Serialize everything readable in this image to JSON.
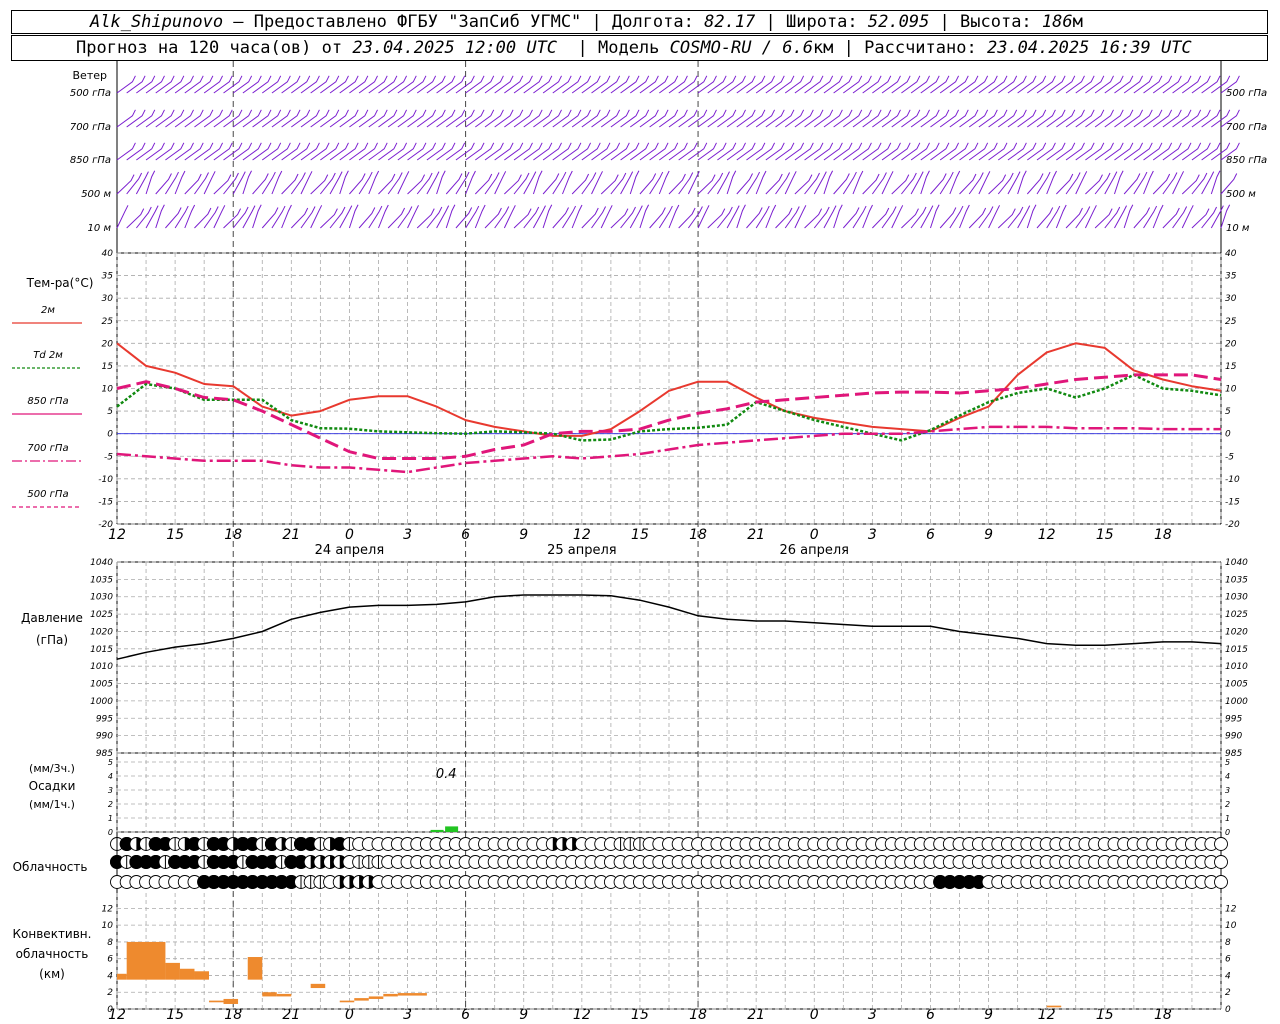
{
  "header": {
    "station": "Alk_Shipunovo",
    "provided_by": " – Предоставлено ФГБУ \"ЗапСиб УГМС\" | Долгота: ",
    "lon": "82.17",
    "lat_label": " | Широта: ",
    "lat": "52.095",
    "alt_label": " | Высота: ",
    "alt": "186",
    "alt_unit": "м",
    "forecast_label": "Прогноз на 120 часа(ов) от ",
    "forecast_time": "23.04.2025 12:00 UTC",
    "model_label": "  | Модель ",
    "model": "COSMO-RU / 6.6",
    "model_unit": "км",
    "calc_label": " | Рассчитано: ",
    "calc_time": "23.04.2025 16:39 UTC"
  },
  "x_axis": {
    "hour_ticks": [
      "12",
      "15",
      "18",
      "21",
      "0",
      "3",
      "6",
      "9",
      "12",
      "15",
      "18",
      "21",
      "0",
      "3",
      "6",
      "9",
      "12",
      "15",
      "18"
    ],
    "day_labels": [
      "24 апреля",
      "25 апреля",
      "26 апреля"
    ]
  },
  "colors": {
    "wind": "#7b1fd0",
    "t2m": "#e8392f",
    "td2m": "#118a11",
    "t850": "#e0167a",
    "t700": "#e0167a",
    "t500": "#e0167a",
    "zero_line": "#2a2ae0",
    "precip": "#22c422",
    "convective": "#ee8a2e",
    "pressure": "#000000"
  },
  "chart_data": [
    {
      "type": "wind_barbs",
      "panel_label": "Ветер",
      "levels": [
        "500 гПа",
        "700 гПа",
        "850 гПа",
        "500 м",
        "10 м"
      ],
      "note": "wind barbs drawn every hour for each level"
    },
    {
      "type": "line",
      "ylabel": "Тем-ра(°C)",
      "ylim": [
        -20,
        40
      ],
      "yticks": [
        -20,
        -15,
        -10,
        -5,
        0,
        5,
        10,
        15,
        20,
        25,
        30,
        35,
        40
      ],
      "x_hours": [
        0,
        3,
        6,
        9,
        12,
        15,
        18,
        21,
        24,
        27,
        30,
        33,
        36,
        39,
        42,
        45,
        48,
        51,
        54,
        57,
        60,
        63,
        66,
        69,
        72,
        75,
        78,
        81,
        84,
        87,
        90,
        93,
        96,
        99,
        102,
        105,
        108,
        111,
        114
      ],
      "series": [
        {
          "name": "2м",
          "values": [
            20,
            15,
            13.5,
            11,
            10.5,
            6,
            4,
            5,
            7.5,
            8.3,
            8.3,
            6,
            3,
            1.5,
            0.5,
            -0.5,
            -0.5,
            1,
            5,
            9.5,
            11.5,
            11.5,
            8,
            5,
            3.5,
            2.5,
            1.5,
            1,
            0.5,
            3.5,
            6,
            13,
            18,
            20,
            19,
            14,
            12,
            10.5,
            9.5
          ]
        },
        {
          "name": "Td 2м",
          "values": [
            6,
            11,
            10,
            7.5,
            7.5,
            7.5,
            3,
            1.2,
            1.1,
            0.5,
            0.3,
            0.1,
            0,
            0.5,
            0.3,
            0,
            -1.5,
            -1.3,
            0.5,
            1,
            1.3,
            2,
            7,
            5,
            3,
            1.5,
            0,
            -1.5,
            0.8,
            4,
            7,
            9,
            10,
            8,
            10,
            13,
            10,
            9.5,
            8.5
          ]
        },
        {
          "name": "850 гПа",
          "values": [
            10,
            11.5,
            10,
            8,
            7.5,
            5,
            2,
            -1,
            -4,
            -5.5,
            -5.5,
            -5.5,
            -5,
            -3.5,
            -2.5,
            0,
            0.5,
            0.5,
            1,
            3,
            4.5,
            5.5,
            7,
            7.5,
            8,
            8.5,
            9,
            9.2,
            9.2,
            9,
            9.5,
            10,
            11,
            12,
            12.5,
            13,
            13,
            13,
            12
          ]
        },
        {
          "name": "700 гПа",
          "values": [
            -4.5,
            -5,
            -5.5,
            -6,
            -6,
            -6,
            -7,
            -7.5,
            -7.5,
            -8,
            -8.5,
            -7.5,
            -6.5,
            -6,
            -5.5,
            -5,
            -5.5,
            -5,
            -4.5,
            -3.5,
            -2.5,
            -2,
            -1.5,
            -1,
            -0.5,
            0,
            0,
            0,
            0.5,
            1,
            1.5,
            1.5,
            1.5,
            1.2,
            1.2,
            1.2,
            1,
            1,
            1
          ]
        },
        {
          "name": "500 гПа",
          "values": []
        }
      ]
    },
    {
      "type": "line",
      "ylabel": "Давление",
      "unit": "(гПа)",
      "ylim": [
        985,
        1040
      ],
      "yticks": [
        985,
        990,
        995,
        1000,
        1005,
        1010,
        1015,
        1020,
        1025,
        1030,
        1035,
        1040
      ],
      "x_hours": [
        0,
        3,
        6,
        9,
        12,
        15,
        18,
        21,
        24,
        27,
        30,
        33,
        36,
        39,
        42,
        45,
        48,
        51,
        54,
        57,
        60,
        63,
        66,
        69,
        72,
        75,
        78,
        81,
        84,
        87,
        90,
        93,
        96,
        99,
        102,
        105,
        108,
        111,
        114
      ],
      "series": [
        {
          "name": "Давление",
          "values": [
            1012,
            1014,
            1015.5,
            1016.5,
            1018,
            1020,
            1023.5,
            1025.5,
            1027,
            1027.5,
            1027.5,
            1027.8,
            1028.5,
            1030,
            1030.5,
            1030.5,
            1030.5,
            1030.3,
            1029,
            1027,
            1024.5,
            1023.5,
            1023,
            1023,
            1022.5,
            1022,
            1021.5,
            1021.5,
            1021.5,
            1020,
            1019,
            1018,
            1016.5,
            1016,
            1016,
            1016.5,
            1017,
            1017,
            1016.5
          ]
        }
      ]
    },
    {
      "type": "bar",
      "ylabel": "Осадки",
      "unit_top": "(мм/3ч.)",
      "unit_bottom": "(мм/1ч.)",
      "ylim": [
        0,
        5
      ],
      "yticks": [
        0,
        1,
        2,
        3,
        4,
        5
      ],
      "annotation": "0.4",
      "bars": [
        {
          "x_hour": 33,
          "value": 0.15
        },
        {
          "x_hour": 34.5,
          "value": 0.4
        }
      ]
    },
    {
      "type": "table",
      "ylabel": "Облачность",
      "rows": 3,
      "note": "cloud cover symbols (octas) per hour; high / middle / low"
    },
    {
      "type": "bar",
      "ylabel": "Конвективн. облачность (км)",
      "ylim": [
        0,
        13
      ],
      "yticks": [
        0,
        2,
        4,
        6,
        8,
        10,
        12
      ],
      "bars": [
        {
          "x0": 0,
          "x1": 1,
          "bottom": 3.5,
          "top": 4.2
        },
        {
          "x0": 1,
          "x1": 5,
          "bottom": 3.5,
          "top": 8
        },
        {
          "x0": 5,
          "x1": 6.5,
          "bottom": 3.5,
          "top": 5.5
        },
        {
          "x0": 6.5,
          "x1": 8,
          "bottom": 3.5,
          "top": 4.8
        },
        {
          "x0": 8,
          "x1": 9.5,
          "bottom": 3.5,
          "top": 4.5
        },
        {
          "x0": 9.5,
          "x1": 11,
          "bottom": 0.8,
          "top": 1
        },
        {
          "x0": 11,
          "x1": 12.5,
          "bottom": 0.6,
          "top": 1.2
        },
        {
          "x0": 13.5,
          "x1": 15,
          "bottom": 3.5,
          "top": 6.2
        },
        {
          "x0": 15,
          "x1": 16.5,
          "bottom": 1.5,
          "top": 2
        },
        {
          "x0": 16.5,
          "x1": 18,
          "bottom": 1.5,
          "top": 1.8
        },
        {
          "x0": 20,
          "x1": 21.5,
          "bottom": 2.5,
          "top": 3
        },
        {
          "x0": 23,
          "x1": 24.5,
          "bottom": 0.8,
          "top": 1
        },
        {
          "x0": 24.5,
          "x1": 26,
          "bottom": 1,
          "top": 1.3
        },
        {
          "x0": 26,
          "x1": 27.5,
          "bottom": 1.2,
          "top": 1.5
        },
        {
          "x0": 27.5,
          "x1": 29,
          "bottom": 1.5,
          "top": 1.8
        },
        {
          "x0": 29,
          "x1": 32,
          "bottom": 1.6,
          "top": 1.9
        },
        {
          "x0": 96,
          "x1": 97.5,
          "bottom": 0.2,
          "top": 0.4
        }
      ]
    }
  ]
}
